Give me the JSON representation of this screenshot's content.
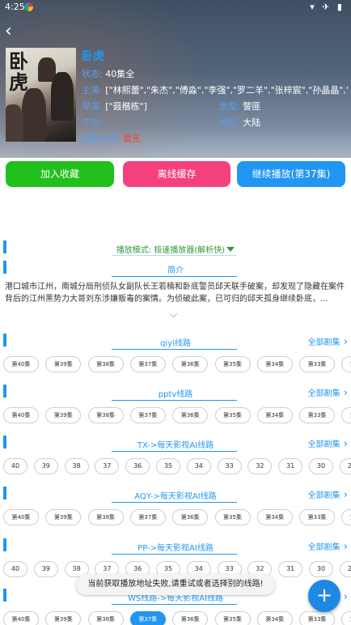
{
  "status_bar": {
    "time": "4:25",
    "icons": "▾ ✈ ▮"
  },
  "detail": {
    "title": "卧虎",
    "poster_title": "卧虎",
    "status_label": "状态:",
    "status_value": "40集全",
    "actors_label": "主演:",
    "actors_value": "[\"林熙蕾\",\"朱杰\",\"傅淼\",\"李强\",\"罗二羊\",\"张梓宸\",\"孙晶晶\",\"刘佳\",\"霍青\"]",
    "director_label": "导演:",
    "director_value": "[\"聂楷栋\"]",
    "genre_label": "类型:",
    "genre_value": "警匪",
    "year_label": "年份:",
    "year_value": "",
    "region_label": "地区:",
    "region_value": "大陆",
    "update_label": "更新时间:",
    "update_value": "暂无"
  },
  "actions": {
    "favorite": "加入收藏",
    "offline_cache": "离线缓存",
    "continue_play": "继续播放(第37集)"
  },
  "play_mode": "播放模式: 极速播放器(解析快)",
  "intro": {
    "title": "简介",
    "text": "港口城市江州，南城分局刑侦队女副队长王若楠和卧底警员邱天联手破案，却发现了隐藏在案件背后的江州黑势力大哥刘东涉嫌贩毒的案情。为侦破此案，已可归的邱天孤身继续卧底，..."
  },
  "all_episodes_label": "全部剧集",
  "routes": [
    {
      "name": "qiyi线路",
      "episodes": [
        "第40集",
        "第39集",
        "第38集",
        "第37集",
        "第36集",
        "第35集",
        "第34集",
        "第33集",
        "第32集"
      ],
      "selected": -1
    },
    {
      "name": "pptv线路",
      "episodes": [
        "第40集",
        "第39集",
        "第38集",
        "第37集",
        "第36集",
        "第35集",
        "第34集",
        "第33集",
        "第32集"
      ],
      "selected": -1
    },
    {
      "name": "TX->每天影视AI线路",
      "episodes": [
        "40",
        "39",
        "38",
        "37",
        "36",
        "35",
        "34",
        "33",
        "32",
        "31",
        "30",
        "29"
      ],
      "selected": -1
    },
    {
      "name": "AQY->每天影视AI线路",
      "episodes": [
        "第40集",
        "第39集",
        "第38集",
        "第37集",
        "第36集",
        "第35集",
        "第34集",
        "第33集",
        "第32集"
      ],
      "selected": -1
    },
    {
      "name": "PP->每天影视AI线路",
      "episodes": [
        "40",
        "39",
        "38",
        "37",
        "36",
        "35",
        "34",
        "33",
        "32",
        "31",
        "30",
        "29"
      ],
      "selected": -1
    },
    {
      "name": "WS线路->每天影视AI线路",
      "episodes": [
        "第40集",
        "第39集",
        "第38集",
        "第37集",
        "第36集",
        "第35集",
        "第34集",
        "第33集",
        "第32集"
      ],
      "selected": 3
    }
  ],
  "toast": "当前获取播放地址失败,请重试或者选择别的线路!",
  "fab": "+",
  "colors": {
    "accent": "#2196f3",
    "favorite": "#22c01c",
    "cache": "#f5407f",
    "continue": "#2196f3",
    "mode": "#2e9a3a",
    "error": "#ff3b30"
  }
}
